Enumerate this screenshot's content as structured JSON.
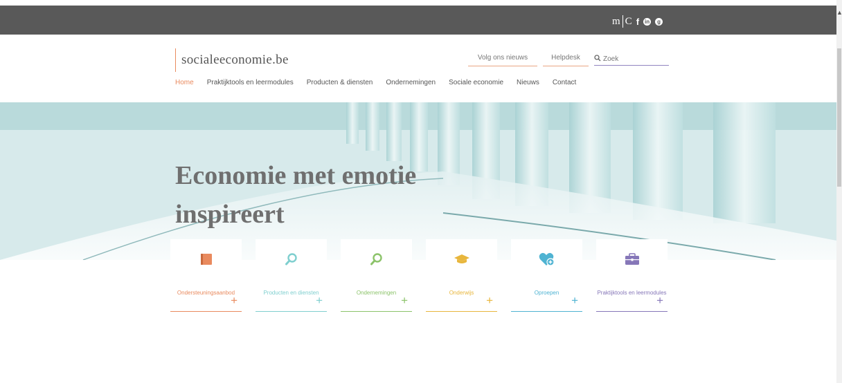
{
  "topbar": {
    "brand_m": "m",
    "brand_c": "C",
    "social_icons": [
      "facebook-icon",
      "linkedin-icon",
      "google-plus-icon"
    ]
  },
  "header": {
    "logo_text": "socialeeconomie.be",
    "links": {
      "nieuws": "Volg ons nieuws",
      "helpdesk": "Helpdesk"
    },
    "search": {
      "placeholder": "Zoek"
    }
  },
  "nav": {
    "items": [
      "Home",
      "Praktijktools en leermodules",
      "Producten & diensten",
      "Ondernemingen",
      "Sociale economie",
      "Nieuws",
      "Contact"
    ],
    "active": "Home"
  },
  "hero": {
    "title": "Economie met emotie inspireert"
  },
  "cards": [
    {
      "label": "Ondersteuningsaanbod",
      "icon": "book-icon",
      "color": "#e98a5e"
    },
    {
      "label": "Producten en diensten",
      "icon": "search-icon",
      "color": "#7fcfcf"
    },
    {
      "label": "Ondernemingen",
      "icon": "search-icon",
      "color": "#8cc36a"
    },
    {
      "label": "Onderwijs",
      "icon": "graduation-cap-icon",
      "color": "#e8b63c"
    },
    {
      "label": "Oproepen",
      "icon": "heart-plus-icon",
      "color": "#4fb3d2"
    },
    {
      "label": "Praktijktools en leermodules",
      "icon": "briefcase-icon",
      "color": "#8677b8"
    }
  ],
  "colors": {
    "accent": "#e98a5e",
    "topbar": "#595959",
    "search_underline": "#8f83bf"
  }
}
